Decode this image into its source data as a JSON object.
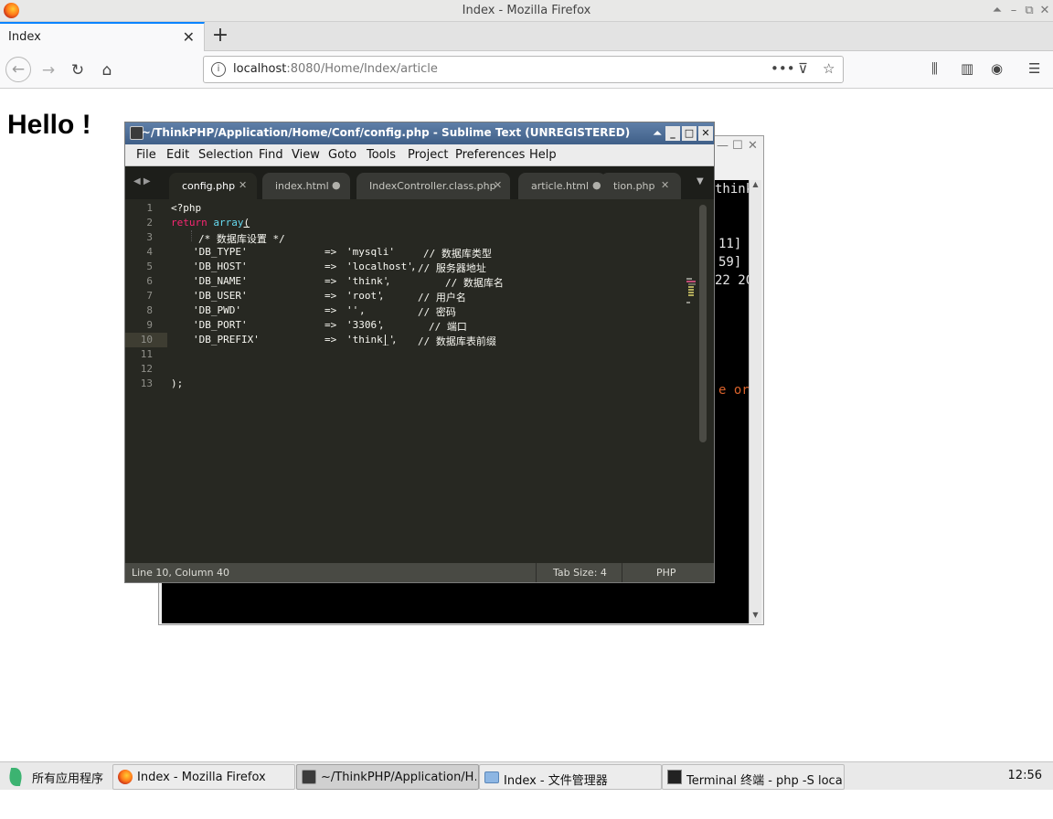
{
  "firefox": {
    "window_title": "Index - Mozilla Firefox",
    "tab_label": "Index",
    "url_host": "localhost",
    "url_rest": ":8080/Home/Index/article",
    "page_heading": "Hello !"
  },
  "terminal": {
    "lines": [
      "think",
      "11]",
      "59]",
      "22 20",
      "e or"
    ]
  },
  "sublime": {
    "title": "~/ThinkPHP/Application/Home/Conf/config.php - Sublime Text (UNREGISTERED)",
    "menu": [
      "File",
      "Edit",
      "Selection",
      "Find",
      "View",
      "Goto",
      "Tools",
      "Project",
      "Preferences",
      "Help"
    ],
    "tabs": [
      "config.php",
      "index.html",
      "IndexController.class.php",
      "article.html",
      "tion.php"
    ],
    "line_numbers": [
      "1",
      "2",
      "3",
      "4",
      "5",
      "6",
      "7",
      "8",
      "9",
      "10",
      "11",
      "12",
      "13"
    ],
    "code": {
      "l1": "<?php",
      "l2_kw": "return",
      "l2_fn": "array",
      "l2_paren": "(",
      "l3": "/* 数据库设置 */",
      "keys": [
        "'DB_TYPE'",
        "'DB_HOST'",
        "'DB_NAME'",
        "'DB_USER'",
        "'DB_PWD'",
        "'DB_PORT'",
        "'DB_PREFIX'"
      ],
      "arrow": "=>",
      "vals": [
        "'mysqli'",
        "'localhost'",
        "'think'",
        "'root'",
        "''",
        "'3306'",
        "'think_'"
      ],
      "comments": [
        "// 数据库类型",
        "// 服务器地址",
        "// 数据库名",
        "// 用户名",
        "// 密码",
        "// 端口",
        "// 数据库表前缀"
      ],
      "l13": ");"
    },
    "status": {
      "position": "Line 10, Column 40",
      "tab_size": "Tab Size: 4",
      "syntax": "PHP"
    }
  },
  "taskbar": {
    "start_label": "所有应用程序",
    "items": [
      "Index - Mozilla Firefox",
      "~/ThinkPHP/Application/H…",
      "Index - 文件管理器",
      "Terminal 终端 - php -S local…"
    ],
    "clock": "12:56"
  },
  "colors": {
    "sublime_bg": "#272822",
    "keyword": "#f92672",
    "function": "#66d9ef",
    "string": "#e6db74",
    "comment": "#75715e",
    "firefox_accent": "#0a84ff"
  }
}
